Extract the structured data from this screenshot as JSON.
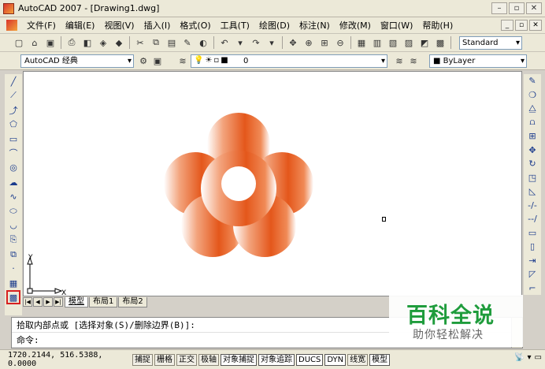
{
  "window": {
    "title": "AutoCAD 2007 - [Drawing1.dwg]",
    "controls": [
      "–",
      "▫",
      "✕"
    ]
  },
  "menu": {
    "items": [
      "文件(F)",
      "编辑(E)",
      "视图(V)",
      "插入(I)",
      "格式(O)",
      "工具(T)",
      "绘图(D)",
      "标注(N)",
      "修改(M)",
      "窗口(W)",
      "帮助(H)"
    ],
    "mdi_controls": [
      "_",
      "▫",
      "✕"
    ]
  },
  "toolbar": {
    "text_style": "Standard"
  },
  "properties": {
    "workspace": "AutoCAD 经典",
    "layer": "0",
    "color": "ByLayer"
  },
  "canvas": {
    "ucs": {
      "y_label": "Y",
      "x_label": "X"
    },
    "shape_colors": {
      "petal": "#e4571b",
      "petal_fade": "#ffffff",
      "center_hole": "#ffffff"
    }
  },
  "tabs": {
    "nav": [
      "|◀",
      "◀",
      "▶",
      "▶|"
    ],
    "items": [
      "模型",
      "布局1",
      "布局2"
    ],
    "active": "模型"
  },
  "command": {
    "history": "拾取内部点或 [选择对象(S)/删除边界(B)]:",
    "prompt": "命令:"
  },
  "status": {
    "coords": "1720.2144, 516.5388, 0.0000",
    "buttons": [
      "捕捉",
      "栅格",
      "正交",
      "极轴",
      "对象捕捉",
      "对象追踪",
      "DUCS",
      "DYN",
      "线宽",
      "模型"
    ]
  },
  "watermark": {
    "title": "百科全说",
    "subtitle": "助你轻松解决"
  }
}
